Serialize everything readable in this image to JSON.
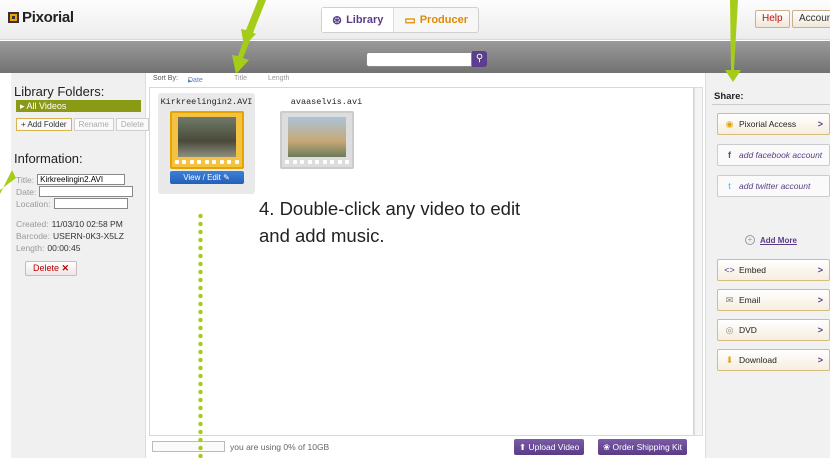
{
  "app": {
    "logo": "Pixorial",
    "tabs": [
      {
        "label": "Library",
        "icon": "library-icon"
      },
      {
        "label": "Producer",
        "icon": "producer-icon"
      }
    ],
    "help_label": "Help",
    "account_label": "Account"
  },
  "search": {
    "placeholder": "",
    "button_icon": "search-icon"
  },
  "left": {
    "folders_heading": "Library Folders:",
    "active_folder": "All Videos",
    "folder_buttons": [
      "Add Folder",
      "Rename",
      "Delete"
    ],
    "info_heading": "Information:",
    "title_label": "Title:",
    "title_value": "Kirkreelingin2.AVI",
    "date_label": "Date:",
    "location_label": "Location:",
    "created_label": "Created:",
    "created_value": "11/03/10 02:58 PM",
    "barcode_label": "Barcode:",
    "barcode_value": "USERN-0K3-X5LZ",
    "length_label": "Length:",
    "length_value": "00:00:45",
    "delete_label": "Delete"
  },
  "sort": {
    "label": "Sort By:",
    "options": [
      "Date",
      "Title",
      "Length"
    ]
  },
  "videos": [
    {
      "title": "Kirkreelingin2.AVI",
      "action": "View / Edit"
    },
    {
      "title": "avaaselvis.avi"
    }
  ],
  "instruction": "4. Double-click any video to edit and add music.",
  "storage": {
    "text": "you are using 0% of 10GB",
    "used_percent": 0
  },
  "bottom_buttons": {
    "upload": "Upload Video",
    "order": "Order Shipping Kit"
  },
  "share": {
    "heading": "Share:",
    "access": "Pixorial Access",
    "facebook": "add facebook account",
    "twitter": "add twitter account",
    "add_more": "Add More",
    "embed": "Embed",
    "email": "Email",
    "dvd": "DVD",
    "download": "Download"
  },
  "colors": {
    "accent": "#5a3c86",
    "highlight": "#e6a400",
    "annotation": "#a6cc1a",
    "folder_active": "#8a9a14"
  }
}
